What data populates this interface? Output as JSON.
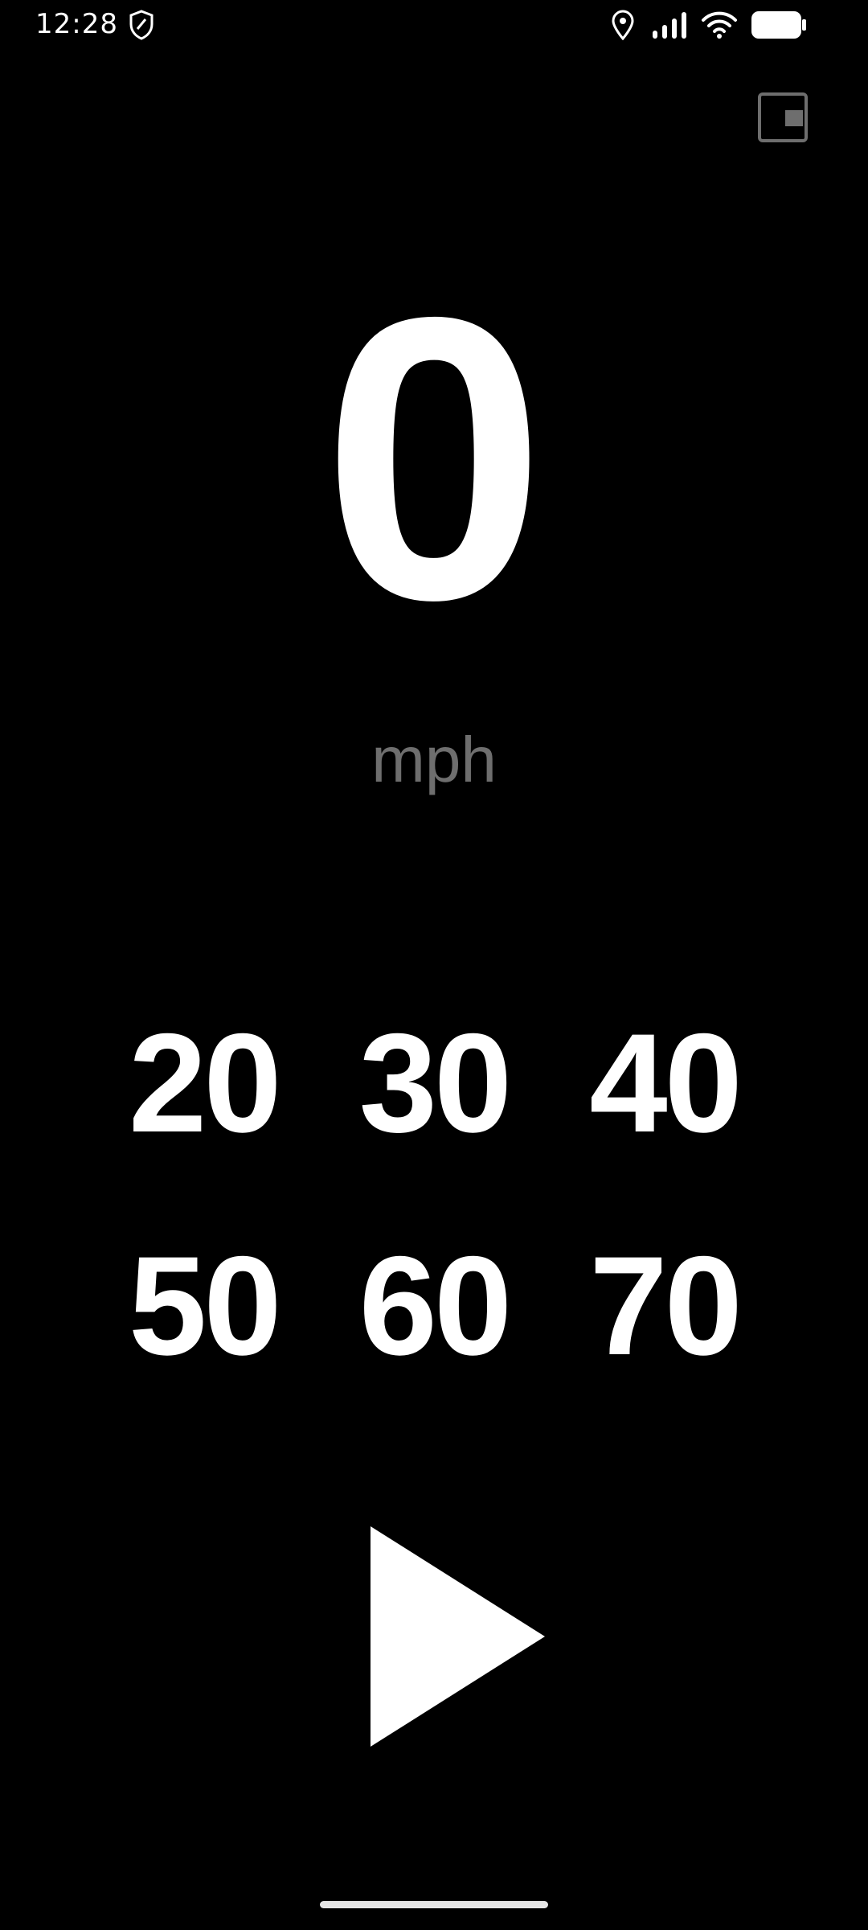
{
  "status_bar": {
    "time": "12:28",
    "icons": [
      "shield-icon",
      "location-icon",
      "signal-icon",
      "wifi-icon",
      "battery-icon"
    ]
  },
  "toolbar": {
    "pip_icon": "picture-in-picture-icon"
  },
  "speedometer": {
    "value": "0",
    "unit": "mph"
  },
  "presets": [
    "20",
    "30",
    "40",
    "50",
    "60",
    "70"
  ],
  "controls": {
    "play_icon": "play-icon"
  },
  "colors": {
    "background": "#000000",
    "primary_text": "#ffffff",
    "unit_text": "#6e6e6e",
    "pip_icon": "#6e6e6e"
  }
}
